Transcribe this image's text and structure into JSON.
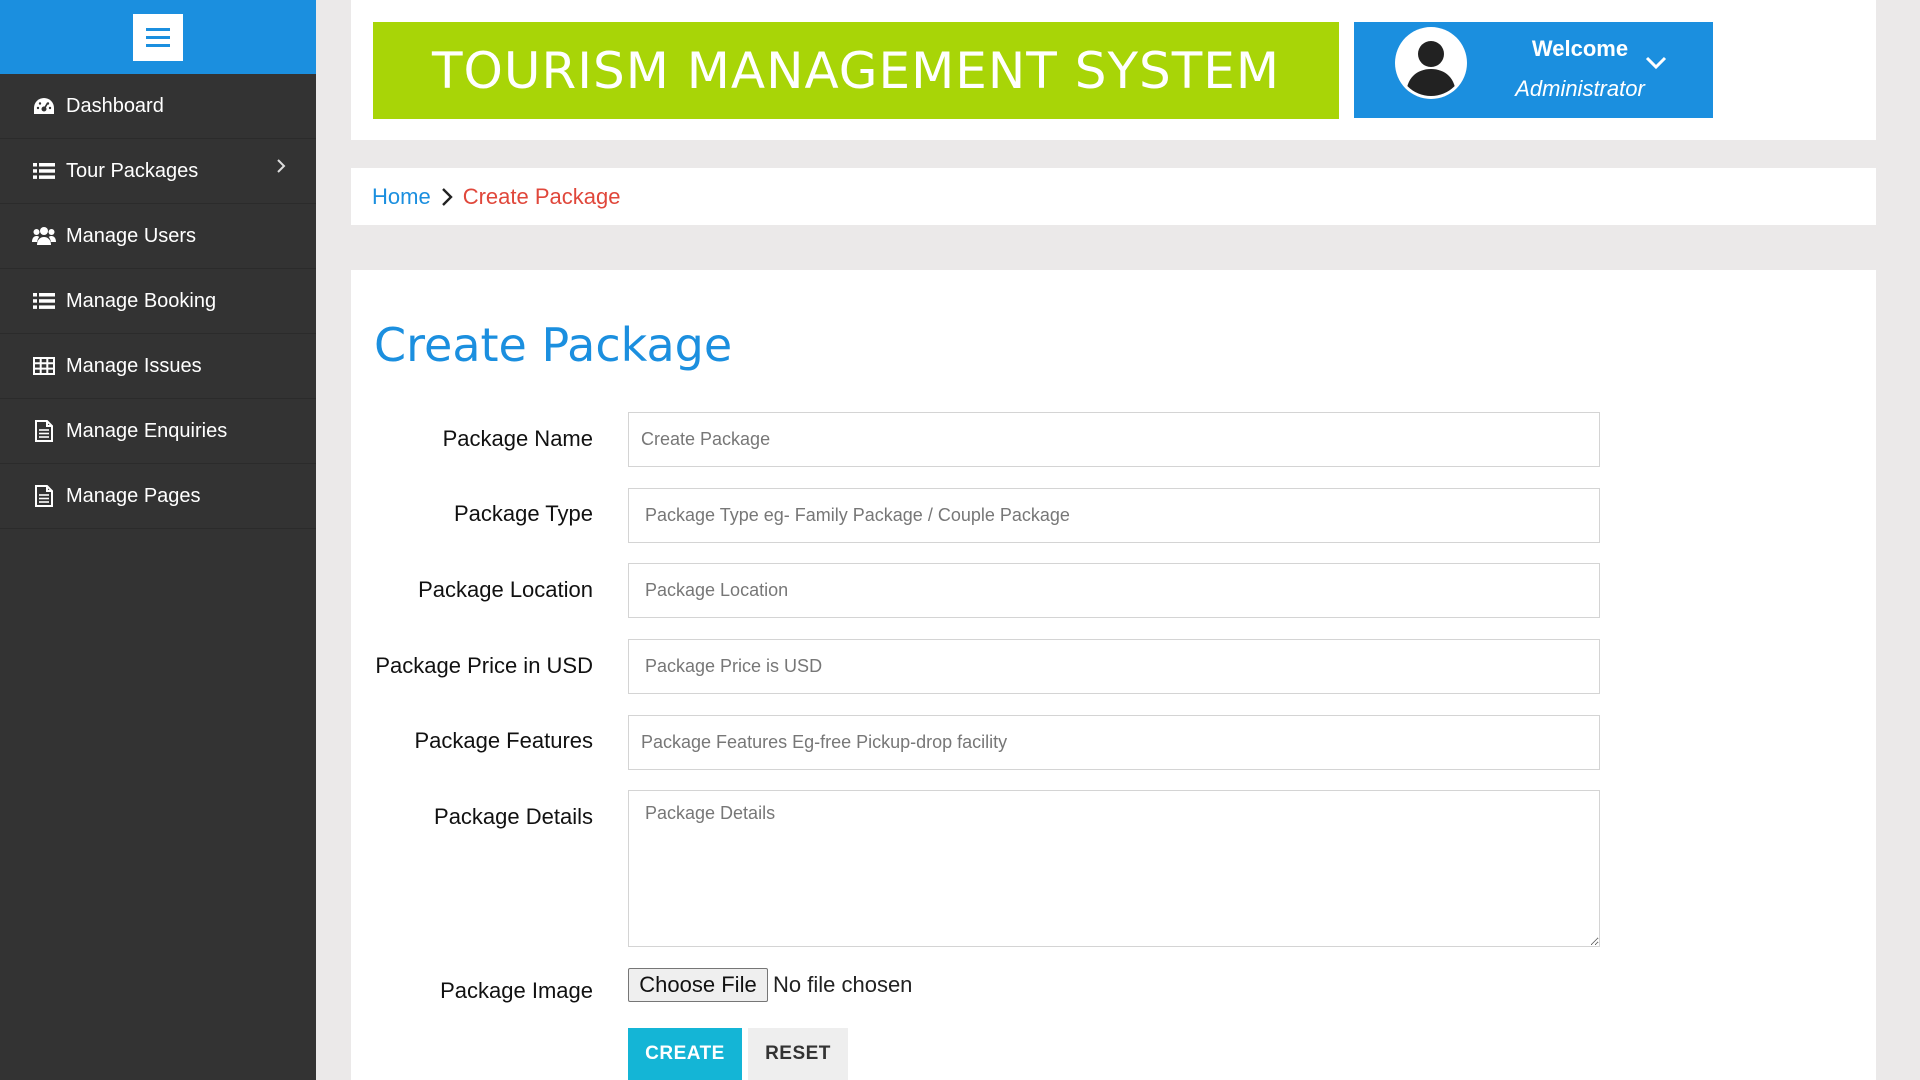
{
  "header": {
    "brand_title": "TOURISM MANAGEMENT SYSTEM",
    "welcome": "Welcome",
    "role": "Administrator"
  },
  "sidebar": {
    "items": [
      {
        "label": "Dashboard",
        "icon": "dashboard-icon"
      },
      {
        "label": "Tour Packages",
        "icon": "list-icon",
        "has_submenu": true
      },
      {
        "label": "Manage Users",
        "icon": "users-icon"
      },
      {
        "label": "Manage Booking",
        "icon": "list-icon"
      },
      {
        "label": "Manage Issues",
        "icon": "table-icon"
      },
      {
        "label": "Manage Enquiries",
        "icon": "document-icon"
      },
      {
        "label": "Manage Pages",
        "icon": "document-icon"
      }
    ]
  },
  "breadcrumb": {
    "home": "Home",
    "current": "Create Package"
  },
  "form": {
    "title": "Create Package",
    "fields": [
      {
        "label": "Package Name",
        "placeholder": "Create Package",
        "value": ""
      },
      {
        "label": "Package Type",
        "placeholder": "Package Type eg- Family Package / Couple Package",
        "value": ""
      },
      {
        "label": "Package Location",
        "placeholder": "Package Location",
        "value": ""
      },
      {
        "label": "Package Price in USD",
        "placeholder": "Package Price is USD",
        "value": ""
      },
      {
        "label": "Package Features",
        "placeholder": "Package Features Eg-free Pickup-drop facility",
        "value": ""
      },
      {
        "label": "Package Details",
        "placeholder": "Package Details",
        "value": ""
      }
    ],
    "image_label": "Package Image",
    "file_button": "Choose File",
    "file_status": "No file chosen",
    "create_label": "CREATE",
    "reset_label": "RESET"
  },
  "colors": {
    "sidebar_bg": "#333333",
    "accent_blue": "#1b8fdf",
    "brand_green": "#a8d507",
    "crumb_current": "#e0473b",
    "create_button": "#14b5d6"
  }
}
